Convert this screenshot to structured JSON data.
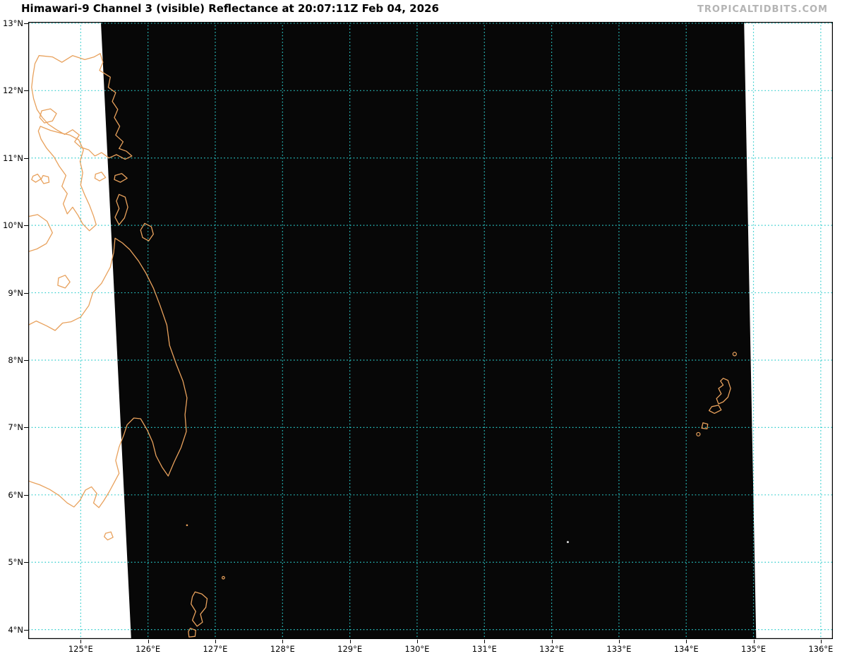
{
  "header": {
    "title": "Himawari-9 Channel 3 (visible) Reflectance at 20:07:11Z Feb 04, 2026",
    "watermark": "TROPICALTIDBITS.COM"
  },
  "map": {
    "projection": {
      "lon_min": 124.22,
      "lon_max": 136.18,
      "lat_min": 3.86,
      "lat_max": 13.02
    },
    "lon_ticks": [
      {
        "value": 125,
        "label": "125°E"
      },
      {
        "value": 126,
        "label": "126°E"
      },
      {
        "value": 127,
        "label": "127°E"
      },
      {
        "value": 128,
        "label": "128°E"
      },
      {
        "value": 129,
        "label": "129°E"
      },
      {
        "value": 130,
        "label": "130°E"
      },
      {
        "value": 131,
        "label": "131°E"
      },
      {
        "value": 132,
        "label": "132°E"
      },
      {
        "value": 133,
        "label": "133°E"
      },
      {
        "value": 134,
        "label": "134°E"
      },
      {
        "value": 135,
        "label": "135°E"
      },
      {
        "value": 136,
        "label": "136°E"
      }
    ],
    "lat_ticks": [
      {
        "value": 13,
        "label": "13°N"
      },
      {
        "value": 12,
        "label": "12°N"
      },
      {
        "value": 11,
        "label": "11°N"
      },
      {
        "value": 10,
        "label": "10°N"
      },
      {
        "value": 9,
        "label": "9°N"
      },
      {
        "value": 8,
        "label": "8°N"
      },
      {
        "value": 7,
        "label": "7°N"
      },
      {
        "value": 6,
        "label": "6°N"
      },
      {
        "value": 5,
        "label": "5°N"
      },
      {
        "value": 4,
        "label": "4°N"
      }
    ],
    "colors": {
      "background": "#ffffff",
      "satellite": "#070707",
      "grid": "#2bcccc",
      "coast": "#e8a15c",
      "border": "#000000",
      "speck": "#d9d9d9"
    },
    "satellite_swath": [
      [
        125.3,
        13.02
      ],
      [
        134.86,
        13.02
      ],
      [
        135.04,
        3.86
      ],
      [
        125.75,
        3.86
      ]
    ],
    "coastlines": [
      {
        "name": "samar",
        "closed": true,
        "points": [
          [
            124.32,
            12.4
          ],
          [
            124.38,
            12.52
          ],
          [
            124.58,
            12.5
          ],
          [
            124.72,
            12.42
          ],
          [
            124.88,
            12.52
          ],
          [
            125.06,
            12.46
          ],
          [
            125.2,
            12.5
          ],
          [
            125.29,
            12.55
          ],
          [
            125.33,
            12.42
          ],
          [
            125.28,
            12.3
          ],
          [
            125.44,
            12.2
          ],
          [
            125.41,
            12.05
          ],
          [
            125.52,
            11.97
          ],
          [
            125.47,
            11.84
          ],
          [
            125.55,
            11.72
          ],
          [
            125.5,
            11.6
          ],
          [
            125.58,
            11.47
          ],
          [
            125.52,
            11.34
          ],
          [
            125.63,
            11.24
          ],
          [
            125.57,
            11.14
          ],
          [
            125.68,
            11.1
          ],
          [
            125.76,
            11.03
          ],
          [
            125.66,
            10.98
          ],
          [
            125.53,
            11.05
          ],
          [
            125.42,
            11.0
          ],
          [
            125.31,
            11.08
          ],
          [
            125.21,
            11.03
          ],
          [
            125.12,
            11.12
          ],
          [
            125.0,
            11.16
          ],
          [
            124.91,
            11.24
          ],
          [
            124.98,
            11.34
          ],
          [
            124.88,
            11.42
          ],
          [
            124.76,
            11.35
          ],
          [
            124.64,
            11.42
          ],
          [
            124.52,
            11.5
          ],
          [
            124.43,
            11.6
          ],
          [
            124.35,
            11.72
          ],
          [
            124.3,
            11.88
          ],
          [
            124.27,
            12.05
          ],
          [
            124.29,
            12.22
          ]
        ]
      },
      {
        "name": "biliran",
        "closed": true,
        "points": [
          [
            124.42,
            11.7
          ],
          [
            124.55,
            11.73
          ],
          [
            124.64,
            11.66
          ],
          [
            124.58,
            11.55
          ],
          [
            124.46,
            11.52
          ],
          [
            124.39,
            11.6
          ]
        ]
      },
      {
        "name": "leyte",
        "closed": true,
        "points": [
          [
            124.4,
            11.47
          ],
          [
            124.55,
            11.41
          ],
          [
            124.7,
            11.37
          ],
          [
            124.84,
            11.34
          ],
          [
            124.97,
            11.27
          ],
          [
            125.04,
            11.12
          ],
          [
            124.99,
            10.95
          ],
          [
            125.03,
            10.78
          ],
          [
            125.0,
            10.6
          ],
          [
            125.06,
            10.45
          ],
          [
            125.13,
            10.3
          ],
          [
            125.19,
            10.14
          ],
          [
            125.23,
            10.01
          ],
          [
            125.13,
            9.92
          ],
          [
            125.03,
            10.02
          ],
          [
            124.96,
            10.15
          ],
          [
            124.88,
            10.27
          ],
          [
            124.8,
            10.17
          ],
          [
            124.74,
            10.32
          ],
          [
            124.8,
            10.47
          ],
          [
            124.72,
            10.58
          ],
          [
            124.78,
            10.74
          ],
          [
            124.68,
            10.88
          ],
          [
            124.6,
            11.02
          ],
          [
            124.49,
            11.15
          ],
          [
            124.41,
            11.28
          ],
          [
            124.37,
            11.4
          ]
        ]
      },
      {
        "name": "camotes-west",
        "closed": true,
        "points": [
          [
            124.29,
            10.73
          ],
          [
            124.36,
            10.76
          ],
          [
            124.41,
            10.69
          ],
          [
            124.33,
            10.64
          ],
          [
            124.27,
            10.68
          ]
        ]
      },
      {
        "name": "camotes-east",
        "closed": true,
        "points": [
          [
            124.44,
            10.74
          ],
          [
            124.52,
            10.72
          ],
          [
            124.53,
            10.64
          ],
          [
            124.45,
            10.62
          ],
          [
            124.41,
            10.68
          ]
        ]
      },
      {
        "name": "leyte-gulf-islet-west",
        "closed": true,
        "points": [
          [
            125.22,
            10.76
          ],
          [
            125.31,
            10.79
          ],
          [
            125.37,
            10.71
          ],
          [
            125.28,
            10.66
          ],
          [
            125.21,
            10.7
          ]
        ]
      },
      {
        "name": "leyte-gulf-islet-east",
        "closed": true,
        "points": [
          [
            125.51,
            10.74
          ],
          [
            125.61,
            10.77
          ],
          [
            125.69,
            10.7
          ],
          [
            125.59,
            10.64
          ],
          [
            125.5,
            10.68
          ]
        ]
      },
      {
        "name": "dinagat",
        "closed": true,
        "points": [
          [
            125.57,
            10.46
          ],
          [
            125.66,
            10.42
          ],
          [
            125.7,
            10.27
          ],
          [
            125.65,
            10.11
          ],
          [
            125.57,
            10.01
          ],
          [
            125.51,
            10.12
          ],
          [
            125.57,
            10.25
          ],
          [
            125.53,
            10.36
          ]
        ]
      },
      {
        "name": "siargao",
        "closed": true,
        "points": [
          [
            125.95,
            10.03
          ],
          [
            126.05,
            9.98
          ],
          [
            126.08,
            9.87
          ],
          [
            126.01,
            9.77
          ],
          [
            125.92,
            9.82
          ],
          [
            125.89,
            9.93
          ]
        ]
      },
      {
        "name": "bohol-partial",
        "closed": false,
        "points": [
          [
            124.22,
            10.13
          ],
          [
            124.36,
            10.16
          ],
          [
            124.5,
            10.06
          ],
          [
            124.58,
            9.89
          ],
          [
            124.49,
            9.73
          ],
          [
            124.35,
            9.65
          ],
          [
            124.22,
            9.61
          ]
        ]
      },
      {
        "name": "camiguin",
        "closed": true,
        "points": [
          [
            124.67,
            9.22
          ],
          [
            124.77,
            9.26
          ],
          [
            124.84,
            9.16
          ],
          [
            124.77,
            9.07
          ],
          [
            124.66,
            9.11
          ]
        ]
      },
      {
        "name": "mindanao",
        "closed": false,
        "points": [
          [
            124.22,
            8.52
          ],
          [
            124.34,
            8.58
          ],
          [
            124.49,
            8.51
          ],
          [
            124.62,
            8.44
          ],
          [
            124.73,
            8.55
          ],
          [
            124.86,
            8.57
          ],
          [
            125.0,
            8.64
          ],
          [
            125.12,
            8.81
          ],
          [
            125.18,
            9.0
          ],
          [
            125.31,
            9.14
          ],
          [
            125.44,
            9.38
          ],
          [
            125.49,
            9.6
          ],
          [
            125.51,
            9.81
          ],
          [
            125.62,
            9.74
          ],
          [
            125.73,
            9.64
          ],
          [
            125.86,
            9.47
          ],
          [
            125.97,
            9.29
          ],
          [
            126.08,
            9.07
          ],
          [
            126.18,
            8.81
          ],
          [
            126.28,
            8.52
          ],
          [
            126.32,
            8.22
          ],
          [
            126.42,
            7.94
          ],
          [
            126.52,
            7.69
          ],
          [
            126.58,
            7.44
          ],
          [
            126.55,
            7.19
          ],
          [
            126.57,
            6.94
          ],
          [
            126.49,
            6.7
          ],
          [
            126.39,
            6.49
          ],
          [
            126.3,
            6.28
          ],
          [
            126.21,
            6.41
          ],
          [
            126.12,
            6.58
          ],
          [
            126.07,
            6.78
          ],
          [
            125.99,
            6.96
          ],
          [
            125.89,
            7.13
          ],
          [
            125.79,
            7.14
          ],
          [
            125.69,
            7.04
          ],
          [
            125.64,
            6.89
          ],
          [
            125.57,
            6.71
          ],
          [
            125.52,
            6.51
          ],
          [
            125.57,
            6.32
          ],
          [
            125.49,
            6.17
          ],
          [
            125.42,
            6.04
          ],
          [
            125.34,
            5.91
          ],
          [
            125.27,
            5.81
          ],
          [
            125.19,
            5.88
          ],
          [
            125.24,
            6.02
          ],
          [
            125.16,
            6.12
          ],
          [
            125.07,
            6.07
          ],
          [
            124.99,
            5.92
          ],
          [
            124.9,
            5.82
          ],
          [
            124.8,
            5.88
          ],
          [
            124.68,
            5.99
          ],
          [
            124.54,
            6.08
          ],
          [
            124.39,
            6.15
          ],
          [
            124.27,
            6.19
          ],
          [
            124.22,
            6.21
          ]
        ]
      },
      {
        "name": "balut-island",
        "closed": true,
        "points": [
          [
            125.37,
            5.43
          ],
          [
            125.45,
            5.45
          ],
          [
            125.48,
            5.37
          ],
          [
            125.4,
            5.33
          ],
          [
            125.35,
            5.38
          ]
        ]
      },
      {
        "name": "talaud-karakelang",
        "closed": true,
        "points": [
          [
            126.7,
            4.56
          ],
          [
            126.8,
            4.53
          ],
          [
            126.88,
            4.46
          ],
          [
            126.86,
            4.33
          ],
          [
            126.78,
            4.23
          ],
          [
            126.81,
            4.11
          ],
          [
            126.73,
            4.05
          ],
          [
            126.66,
            4.14
          ],
          [
            126.71,
            4.27
          ],
          [
            126.64,
            4.38
          ],
          [
            126.66,
            4.49
          ]
        ]
      },
      {
        "name": "talaud-salibabu",
        "closed": true,
        "points": [
          [
            126.63,
            4.02
          ],
          [
            126.71,
            3.99
          ],
          [
            126.7,
            3.9
          ],
          [
            126.61,
            3.89
          ],
          [
            126.6,
            3.97
          ]
        ]
      },
      {
        "name": "palau-babeldaob",
        "closed": true,
        "points": [
          [
            134.55,
            7.73
          ],
          [
            134.62,
            7.7
          ],
          [
            134.66,
            7.58
          ],
          [
            134.62,
            7.45
          ],
          [
            134.55,
            7.38
          ],
          [
            134.48,
            7.35
          ],
          [
            134.45,
            7.43
          ],
          [
            134.52,
            7.5
          ],
          [
            134.48,
            7.58
          ],
          [
            134.55,
            7.63
          ],
          [
            134.51,
            7.69
          ]
        ]
      },
      {
        "name": "palau-koror",
        "closed": true,
        "points": [
          [
            134.38,
            7.31
          ],
          [
            134.48,
            7.33
          ],
          [
            134.52,
            7.26
          ],
          [
            134.42,
            7.21
          ],
          [
            134.34,
            7.25
          ]
        ]
      },
      {
        "name": "palau-peleliu",
        "closed": true,
        "points": [
          [
            134.25,
            7.07
          ],
          [
            134.32,
            7.05
          ],
          [
            134.31,
            6.98
          ],
          [
            134.23,
            6.99
          ]
        ]
      }
    ],
    "island_dots": [
      {
        "name": "kayangel-atoll",
        "lon": 134.72,
        "lat": 8.09,
        "r": 2.5,
        "style": "ring"
      },
      {
        "name": "angaur-island",
        "lon": 134.18,
        "lat": 6.9,
        "r": 2.5,
        "style": "ring"
      },
      {
        "name": "miangas-island",
        "lon": 126.58,
        "lat": 5.55,
        "r": 1.3,
        "style": "fill"
      },
      {
        "name": "nanusa-islet",
        "lon": 127.12,
        "lat": 4.77,
        "r": 1.8,
        "style": "ring"
      },
      {
        "name": "helen-reef-speck",
        "lon": 132.24,
        "lat": 5.3,
        "r": 1.5,
        "style": "speck"
      }
    ]
  }
}
